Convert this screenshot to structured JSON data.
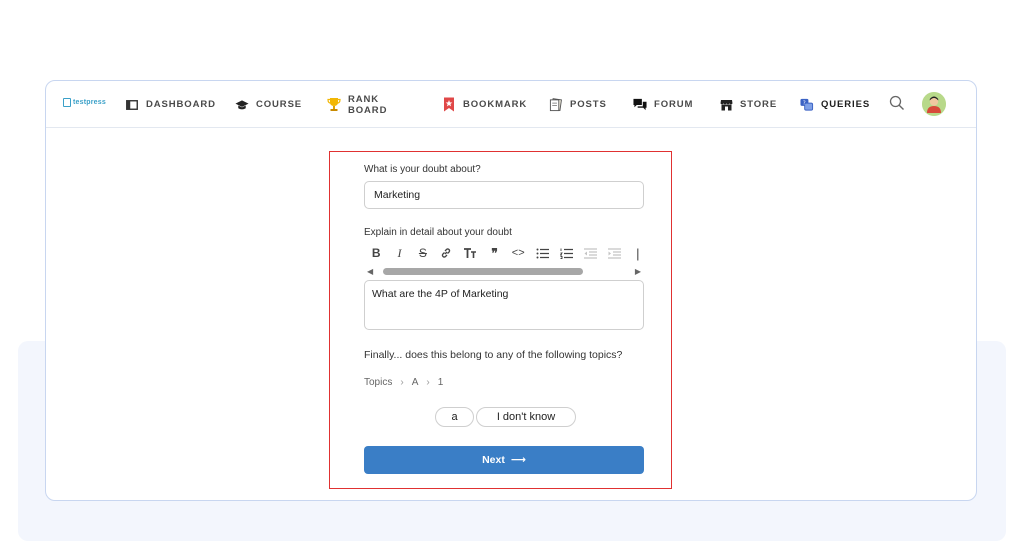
{
  "brand": {
    "logo_text": "testpress"
  },
  "nav": {
    "items": [
      {
        "key": "dashboard",
        "label": "DASHBOARD"
      },
      {
        "key": "course",
        "label": "COURSE"
      },
      {
        "key": "rank",
        "label_line1": "RANK",
        "label_line2": "BOARD"
      },
      {
        "key": "bookmark",
        "label": "BOOKMARK"
      },
      {
        "key": "posts",
        "label": "POSTS"
      },
      {
        "key": "forum",
        "label": "FORUM"
      },
      {
        "key": "store",
        "label": "STORE"
      },
      {
        "key": "queries",
        "label": "QUERIES",
        "active": true
      }
    ]
  },
  "form": {
    "doubt_label": "What is your doubt about?",
    "doubt_value": "Marketing",
    "detail_label": "Explain in detail about your doubt",
    "editor_text": "What are the 4P of Marketing",
    "toolbar": [
      "bold-icon",
      "italic-icon",
      "strikethrough-icon",
      "link-icon",
      "heading-icon",
      "quote-icon",
      "code-icon",
      "bullet-list-icon",
      "numbered-list-icon",
      "outdent-icon",
      "indent-icon",
      "more-icon"
    ],
    "topics_question": "Finally... does this belong to any of the following topics?",
    "breadcrumb": [
      "Topics",
      "A",
      "1"
    ],
    "options": [
      "a",
      "I don't know"
    ],
    "next_label": "Next",
    "next_arrow": "⟶"
  },
  "colors": {
    "accent": "#3a7ec6",
    "highlight_border": "#e03131",
    "queries_icon": "#3b62c4",
    "bookmark_icon": "#e04848"
  }
}
